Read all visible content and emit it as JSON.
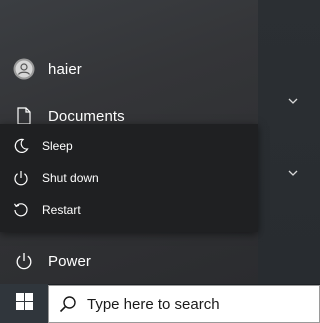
{
  "start_menu": {
    "user": {
      "name": "haier"
    },
    "documents": {
      "label": "Documents"
    },
    "power": {
      "label": "Power"
    }
  },
  "power_menu": {
    "items": [
      {
        "label": "Sleep",
        "icon": "sleep-moon-icon"
      },
      {
        "label": "Shut down",
        "icon": "power-icon"
      },
      {
        "label": "Restart",
        "icon": "restart-icon"
      }
    ]
  },
  "taskbar": {
    "start_icon": "windows-logo-icon",
    "search_placeholder": "Type here to search",
    "search_icon": "search-icon"
  },
  "colors": {
    "menu_bg": "#343538",
    "flyout_bg": "#1f2022",
    "taskbar_bg": "#1c2024",
    "text": "#ffffff"
  }
}
